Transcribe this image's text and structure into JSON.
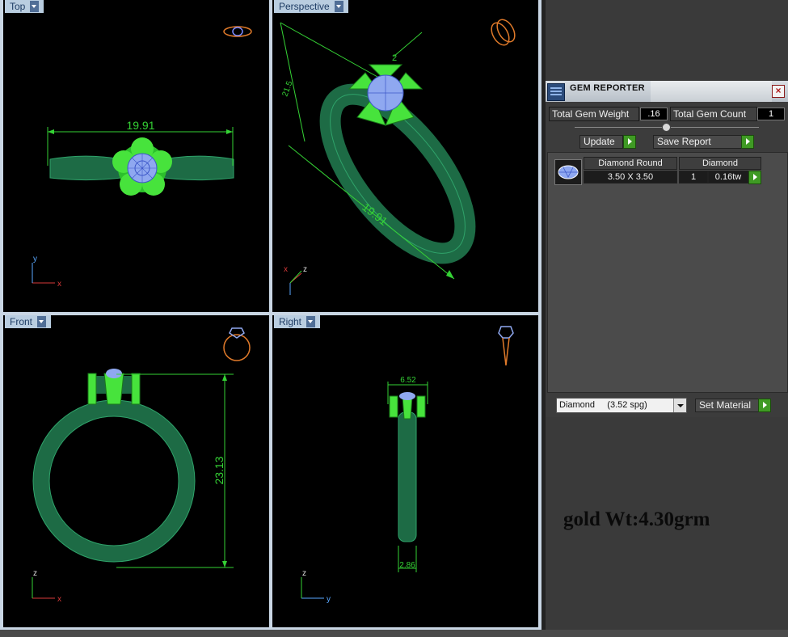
{
  "viewports": {
    "top": {
      "label": "Top",
      "dimension": "19.91",
      "axes": {
        "a": "y",
        "b": "x"
      }
    },
    "perspective": {
      "label": "Perspective",
      "dim_a": "19.91",
      "dim_b": "21.5",
      "dim_c": "2",
      "axes": {
        "a": "x",
        "b": "z"
      }
    },
    "front": {
      "label": "Front",
      "dimension": "23.13",
      "axes": {
        "a": "z",
        "b": "x"
      }
    },
    "right": {
      "label": "Right",
      "dim_top": "6.52",
      "dim_bottom": "2.86",
      "axes": {
        "a": "z",
        "b": "y"
      }
    }
  },
  "gem_reporter": {
    "title": "GEM REPORTER",
    "total_weight_label": "Total Gem Weight",
    "total_weight_value": ".16",
    "total_count_label": "Total Gem Count",
    "total_count_value": "1",
    "update_label": "Update",
    "save_report_label": "Save Report",
    "row": {
      "shape": "Diamond Round",
      "size": "3.50 X 3.50",
      "material": "Diamond",
      "qty": "1",
      "weight": "0.16tw"
    }
  },
  "material_select": {
    "value": "Diamond     (3.52 spg)",
    "set_label": "Set Material"
  },
  "annotation": "gold Wt:4.30grm",
  "colors": {
    "ring": "#1a7a4a",
    "prong": "#3ee23a",
    "gem": "#8fa8f0",
    "dim": "#35d235",
    "icon": "#e07a2a",
    "axis_x": "#d83a3a",
    "axis_y": "#5aa8ff"
  }
}
